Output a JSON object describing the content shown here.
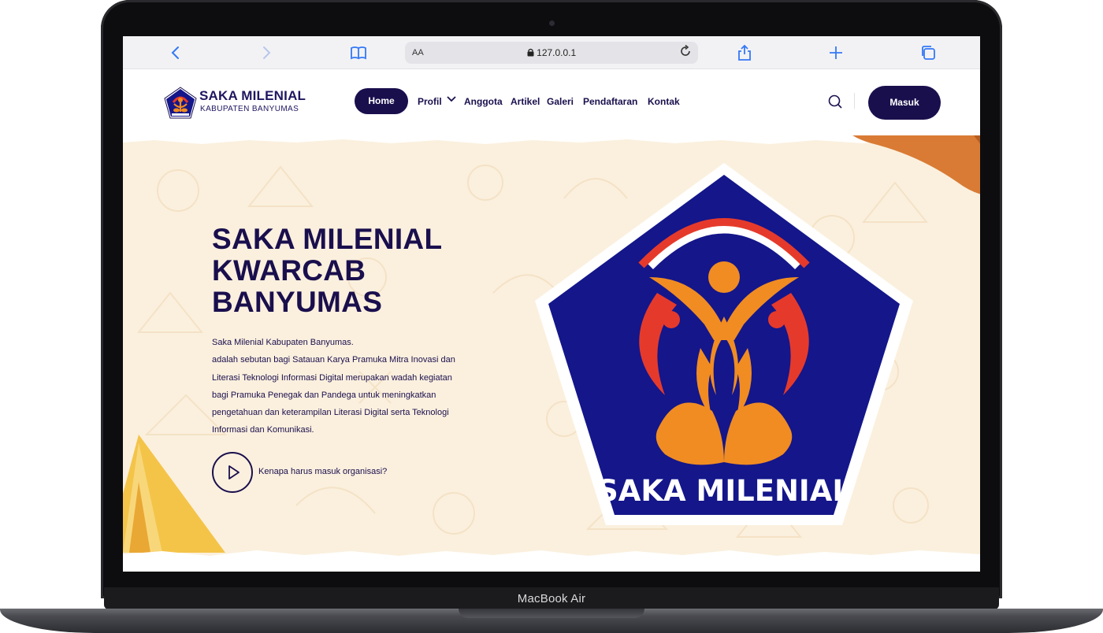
{
  "device": {
    "label": "MacBook Air"
  },
  "browser": {
    "text_size_label": "AA",
    "url": "127.0.0.1",
    "icons": [
      "back-icon",
      "forward-icon",
      "book-icon",
      "lock-icon",
      "reload-icon",
      "share-icon",
      "plus-icon",
      "tabs-icon"
    ]
  },
  "site": {
    "brand": {
      "title": "SAKA MILENIAL",
      "subtitle": "KABUPATEN BANYUMAS"
    },
    "nav": {
      "items": [
        {
          "label": "Home",
          "active": true
        },
        {
          "label": "Profil",
          "dropdown": true
        },
        {
          "label": "Anggota"
        },
        {
          "label": "Artikel"
        },
        {
          "label": "Galeri"
        },
        {
          "label": "Pendaftaran"
        },
        {
          "label": "Kontak"
        }
      ],
      "login_button": "Masuk"
    },
    "hero": {
      "title_lines": [
        "SAKA MILENIAL",
        "KWARCAB",
        "BANYUMAS"
      ],
      "description_lines": [
        "Saka Milenial Kabupaten Banyumas.",
        "adalah sebutan bagi Satauan Karya Pramuka Mitra Inovasi dan",
        "Literasi Teknologi Informasi Digital merupakan wadah kegiatan",
        "bagi Pramuka Penegak dan Pandega untuk meningkatkan",
        "pengetahuan dan keterampilan Literasi Digital serta Teknologi",
        "Informasi dan Komunikasi."
      ],
      "video_link": "Kenapa harus masuk organisasi?",
      "emblem_text": "SAKA MILENIAL"
    }
  },
  "colors": {
    "navy": "#1a0f4d",
    "emblem_blue": "#14168a",
    "emblem_orange": "#f08c22",
    "emblem_red": "#e53a2b",
    "hero_bg": "#fbf0de",
    "browser_accent": "#3478f6"
  }
}
